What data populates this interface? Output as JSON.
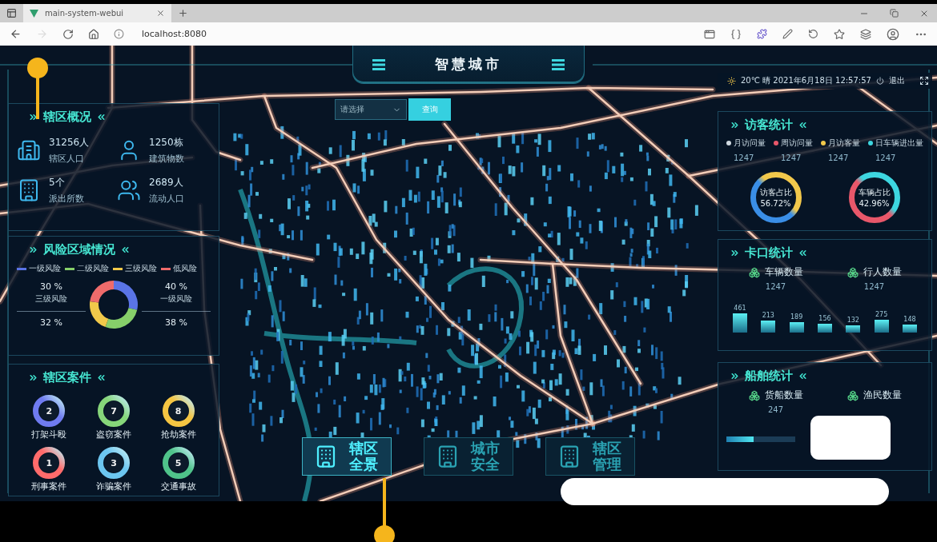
{
  "browser": {
    "tab_title": "main-system-webui",
    "url": "localhost:8080"
  },
  "header": {
    "title": "智慧城市",
    "weather": "20℃ 晴 2021年6月18日 12:57:57",
    "logout": "退出"
  },
  "search": {
    "placeholder": "请选择",
    "button": "查询"
  },
  "district": {
    "title": "辖区概况",
    "stats": [
      {
        "value": "31256人",
        "label": "辖区人口"
      },
      {
        "value": "1250栋",
        "label": "建筑物数"
      },
      {
        "value": "5个",
        "label": "派出所数"
      },
      {
        "value": "2689人",
        "label": "流动人口"
      }
    ]
  },
  "risk": {
    "title": "风险区域情况",
    "legend": [
      {
        "label": "一级风险",
        "color": "#5a74e6"
      },
      {
        "label": "二级风险",
        "color": "#86cf6a"
      },
      {
        "label": "三级风险",
        "color": "#f1c94a"
      },
      {
        "label": "低风险",
        "color": "#ef6b6b"
      }
    ],
    "callouts": [
      {
        "value": "30 %",
        "label": "三级风险"
      },
      {
        "value": "40 %",
        "label": "一级风险"
      },
      {
        "value": "32 %"
      },
      {
        "value": "38 %"
      }
    ],
    "chart_data": {
      "type": "donut",
      "values": [
        28.6,
        27.1,
        21.4,
        22.9
      ]
    }
  },
  "cases": {
    "title": "辖区案件",
    "items": [
      {
        "count": "2",
        "label": "打架斗殴",
        "color": "#6f7bf0"
      },
      {
        "count": "7",
        "label": "盗窃案件",
        "color": "#86d67a"
      },
      {
        "count": "8",
        "label": "抢劫案件",
        "color": "#f5c542"
      },
      {
        "count": "1",
        "label": "刑事案件",
        "color": "#ff6b6b"
      },
      {
        "count": "3",
        "label": "诈骗案件",
        "color": "#6cc6f0"
      },
      {
        "count": "5",
        "label": "交通事故",
        "color": "#4fc38a"
      }
    ]
  },
  "visitors": {
    "title": "访客统计",
    "legend": [
      {
        "label": "月访问量",
        "color": "#cfd8e0",
        "value": "1247"
      },
      {
        "label": "周访问量",
        "color": "#e8576a",
        "value": "1247"
      },
      {
        "label": "月访客量",
        "color": "#f2c84b",
        "value": "1247"
      },
      {
        "label": "日车辆进出量",
        "color": "#3dd6e0",
        "value": "1247"
      }
    ],
    "donuts": [
      {
        "label": "访客占比",
        "reading": "56.72%",
        "color": "#f2c84b"
      },
      {
        "label": "车辆占比",
        "reading": "42.96%",
        "color": "#3dd6e0"
      }
    ]
  },
  "checkpoints": {
    "title": "卡口统计",
    "items": [
      {
        "label": "车辆数量",
        "value": "1247"
      },
      {
        "label": "行人数量",
        "value": "1247"
      }
    ],
    "bar_labels": [
      "461",
      "213",
      "189",
      "156",
      "132",
      "275",
      "148"
    ]
  },
  "ships": {
    "title": "船舶统计",
    "items": [
      {
        "label": "货船数量",
        "value": "247"
      },
      {
        "label": "渔民数量"
      }
    ],
    "progress": {
      "level": 0.4
    }
  },
  "nav": [
    {
      "label": "辖区全景",
      "selected": true
    },
    {
      "label": "城市安全",
      "selected": false
    },
    {
      "label": "辖区管理",
      "selected": false
    }
  ]
}
